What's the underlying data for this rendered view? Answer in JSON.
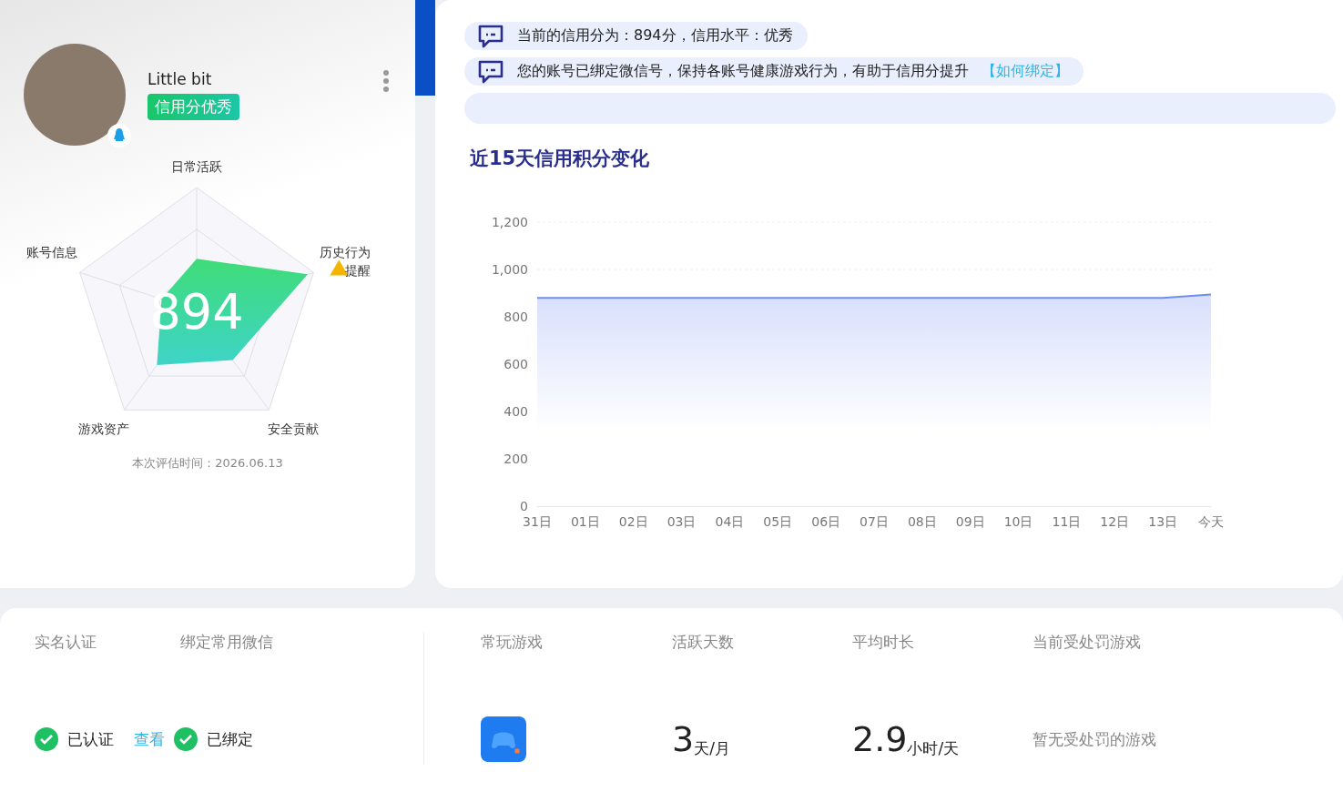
{
  "profile": {
    "name": "Little bit",
    "badge": "信用分优秀",
    "score": "894",
    "radar": [
      {
        "label": "日常活跃"
      },
      {
        "label": "历史行为",
        "warning": "提醒"
      },
      {
        "label": "安全贡献"
      },
      {
        "label": "游戏资产"
      },
      {
        "label": "账号信息"
      }
    ],
    "evaluated": "本次评估时间：2026.06.13"
  },
  "notices": [
    {
      "text": "当前的信用分为：894分，信用水平：优秀"
    },
    {
      "text": "您的账号已绑定微信号，保持各账号健康游戏行为，有助于信用分提升",
      "link": "【如何绑定】"
    }
  ],
  "more_notices_below": true,
  "chart": {
    "title": "近15天信用积分变化",
    "chart_data": {
      "type": "area",
      "categories": [
        "31日",
        "01日",
        "02日",
        "03日",
        "04日",
        "05日",
        "06日",
        "07日",
        "08日",
        "09日",
        "10日",
        "11日",
        "12日",
        "13日",
        "今天"
      ],
      "series": [
        {
          "color": "#6e8ef0",
          "values": [
            880,
            880,
            880,
            880,
            880,
            880,
            880,
            880,
            880,
            880,
            880,
            880,
            880,
            880,
            894
          ]
        }
      ],
      "ylim": [
        0,
        1200
      ],
      "yticks": [
        {
          "value": 0,
          "label": "0"
        },
        {
          "value": 200,
          "label": "200"
        },
        {
          "value": 400,
          "label": "400"
        },
        {
          "value": 600,
          "label": "600"
        },
        {
          "value": 800,
          "label": "800"
        },
        {
          "value": 1000,
          "label": "1,000"
        },
        {
          "value": 1200,
          "label": "1,200"
        }
      ]
    }
  },
  "bindings": [
    {
      "heading": "实名认证",
      "status": "已认证",
      "link": "查看"
    },
    {
      "heading": "绑定常用微信",
      "status": "已绑定"
    }
  ],
  "stats": {
    "game": {
      "heading": "常玩游戏"
    },
    "active": {
      "heading": "活跃天数",
      "value": "3",
      "unit": "天/月"
    },
    "avg": {
      "heading": "平均时长",
      "value": "2.9",
      "unit": "小时/天"
    },
    "penalty": {
      "heading": "当前受处罚游戏",
      "text": "暂无受处罚的游戏"
    }
  }
}
